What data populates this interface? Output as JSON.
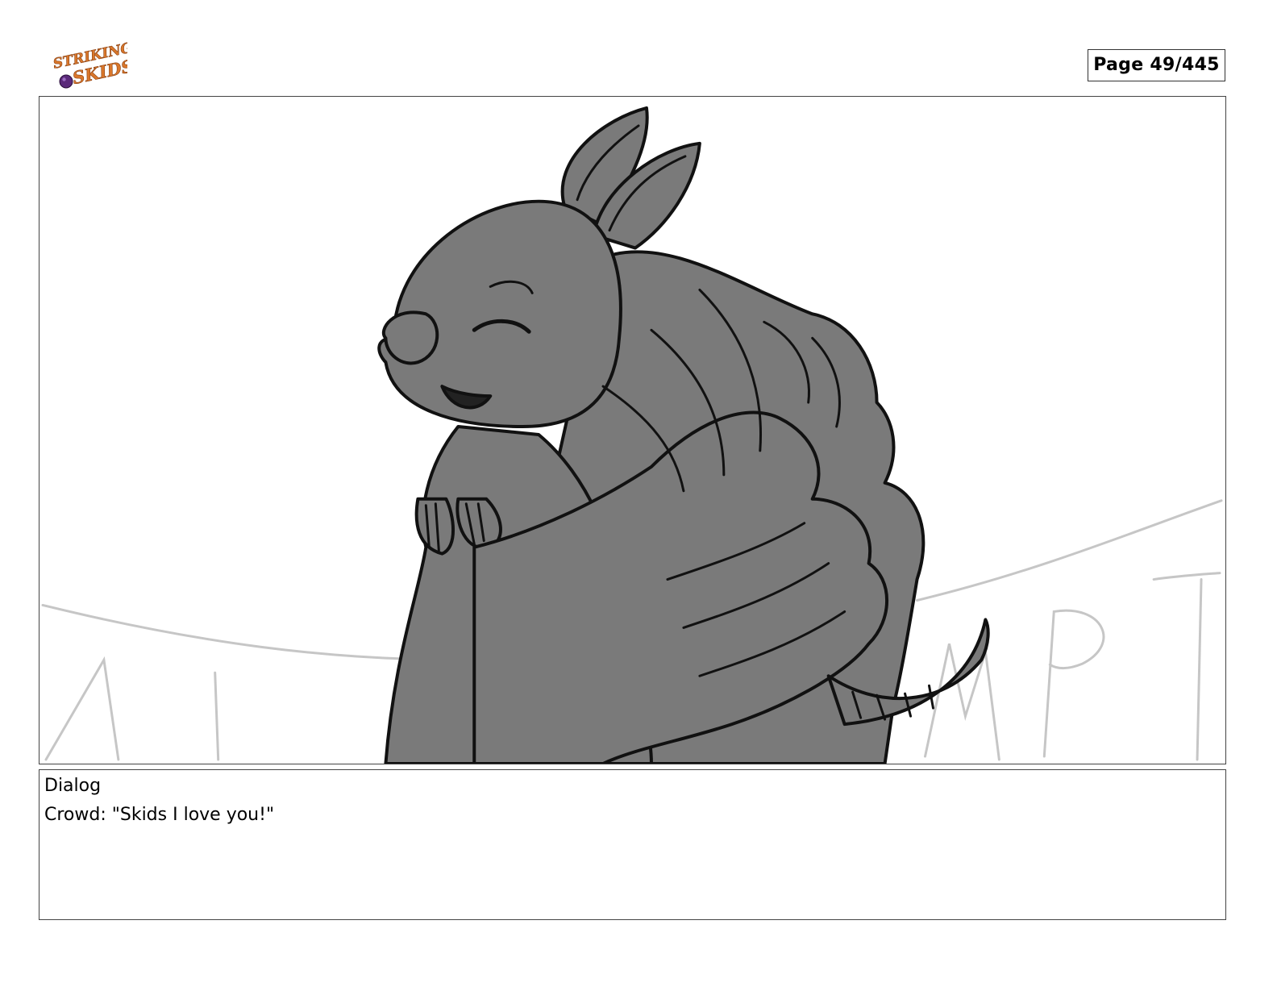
{
  "header": {
    "logo_text_line1": "STRIKING",
    "logo_text_line2": "SKIDS",
    "page_label": "Page",
    "page_number": "49/445",
    "page_indicator": "Page  49/445"
  },
  "panel": {
    "background_text": "MPT",
    "colors": {
      "fill": "#7a7a7a",
      "ink": "#111111",
      "background_sketch": "#c8c8c8",
      "logo_orange": "#d9772b",
      "logo_purple": "#5b2a7a"
    }
  },
  "dialog": {
    "heading": "Dialog",
    "line": "Crowd: \"Skids I love you!\""
  }
}
